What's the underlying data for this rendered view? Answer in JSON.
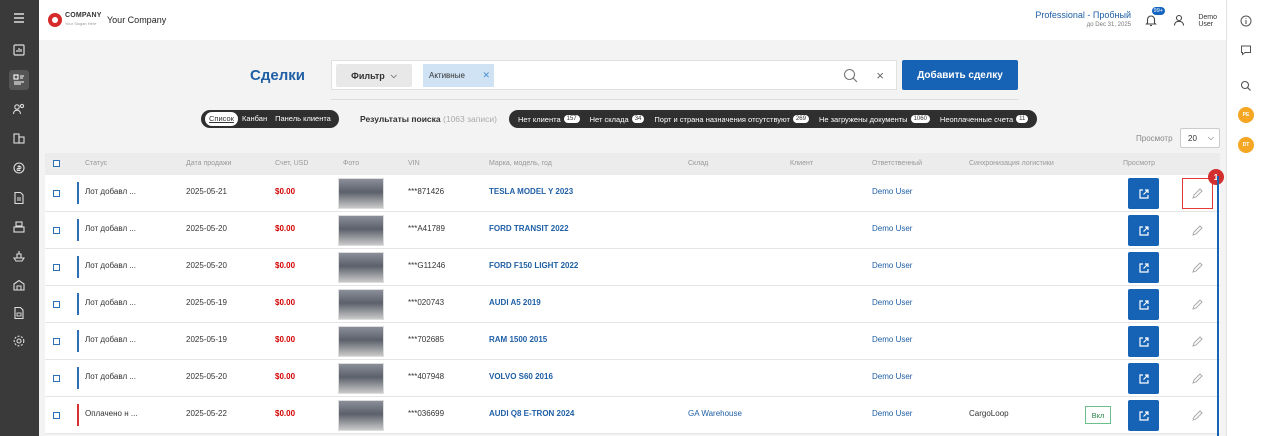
{
  "sidebar": {
    "items": [
      {
        "icon": "menu-icon"
      },
      {
        "icon": "dashboard-icon"
      },
      {
        "icon": "deals-icon",
        "active": true
      },
      {
        "icon": "users-icon"
      },
      {
        "icon": "buildings-icon"
      },
      {
        "icon": "dollar-refresh-icon"
      },
      {
        "icon": "document-icon"
      },
      {
        "icon": "container-icon"
      },
      {
        "icon": "ship-icon"
      },
      {
        "icon": "warehouse-icon"
      },
      {
        "icon": "report-icon"
      },
      {
        "icon": "settings-icon"
      }
    ]
  },
  "header": {
    "logo_line1": "COMPANY",
    "logo_line2": "Your Slogan Here",
    "company_name": "Your Company",
    "plan_title": "Professional - Пробный",
    "plan_until": "до Dec 31, 2025",
    "notifications_badge": "99+",
    "user_first": "Demo",
    "user_last": "User"
  },
  "rightbar": {
    "avatar1": "PE",
    "avatar2": "DT"
  },
  "page": {
    "title": "Сделки",
    "filter_label": "Фильтр",
    "active_tag": "Активные",
    "add_deal_label": "Добавить сделку"
  },
  "views": {
    "list": "Список",
    "kanban": "Канбан",
    "client_panel": "Панель клиента"
  },
  "results": {
    "label": "Результаты поиска",
    "count": "(1063 записи)"
  },
  "quick_filters": [
    {
      "label": "Нет клиента",
      "count": "157"
    },
    {
      "label": "Нет склада",
      "count": "34"
    },
    {
      "label": "Порт и страна назначения отсутствуют",
      "count": "269"
    },
    {
      "label": "Не загружены документы",
      "count": "1060"
    },
    {
      "label": "Неоплаченные счета",
      "count": "11"
    }
  ],
  "pager": {
    "view_label": "Просмотр",
    "per_page": "20"
  },
  "columns": {
    "status": "Статус",
    "sale_date": "Дата продажи",
    "invoice": "Счет, USD",
    "photo": "Фото",
    "vin": "VIN",
    "model": "Марка, модель, год",
    "warehouse": "Склад",
    "client": "Клиент",
    "responsible": "Ответственный",
    "logistics": "Синхронизация логистики",
    "view": "Просмотр"
  },
  "rows": [
    {
      "status": "Лот добавл ...",
      "date": "2025-05-21",
      "price": "$0.00",
      "vin": "***871426",
      "model": "TESLA MODEL Y 2023",
      "warehouse": "",
      "client": "",
      "responsible": "Demo User",
      "logistics": "",
      "incl": "",
      "bar": "blue"
    },
    {
      "status": "Лот добавл ...",
      "date": "2025-05-20",
      "price": "$0.00",
      "vin": "***A41789",
      "model": "FORD TRANSIT 2022",
      "warehouse": "",
      "client": "",
      "responsible": "Demo User",
      "logistics": "",
      "incl": "",
      "bar": "blue"
    },
    {
      "status": "Лот добавл ...",
      "date": "2025-05-20",
      "price": "$0.00",
      "vin": "***G11246",
      "model": "FORD F150 LIGHT 2022",
      "warehouse": "",
      "client": "",
      "responsible": "Demo User",
      "logistics": "",
      "incl": "",
      "bar": "blue"
    },
    {
      "status": "Лот добавл ...",
      "date": "2025-05-19",
      "price": "$0.00",
      "vin": "***020743",
      "model": "AUDI A5 2019",
      "warehouse": "",
      "client": "",
      "responsible": "Demo User",
      "logistics": "",
      "incl": "",
      "bar": "blue"
    },
    {
      "status": "Лот добавл ...",
      "date": "2025-05-19",
      "price": "$0.00",
      "vin": "***702685",
      "model": "RAM 1500 2015",
      "warehouse": "",
      "client": "",
      "responsible": "Demo User",
      "logistics": "",
      "incl": "",
      "bar": "blue"
    },
    {
      "status": "Лот добавл ...",
      "date": "2025-05-20",
      "price": "$0.00",
      "vin": "***407948",
      "model": "VOLVO S60 2016",
      "warehouse": "",
      "client": "",
      "responsible": "Demo User",
      "logistics": "",
      "incl": "",
      "bar": "blue"
    },
    {
      "status": "Оплачено н ...",
      "date": "2025-05-22",
      "price": "$0.00",
      "vin": "***036699",
      "model": "AUDI Q8 E-TRON 2024",
      "warehouse": "GA Warehouse",
      "client": "",
      "responsible": "Demo User",
      "logistics": "CargoLoop",
      "incl": "Вкл",
      "bar": "red"
    }
  ],
  "highlight_marker": "1",
  "colors": {
    "primary": "#1662b4",
    "price": "#d40000",
    "danger": "#d32f2f"
  }
}
